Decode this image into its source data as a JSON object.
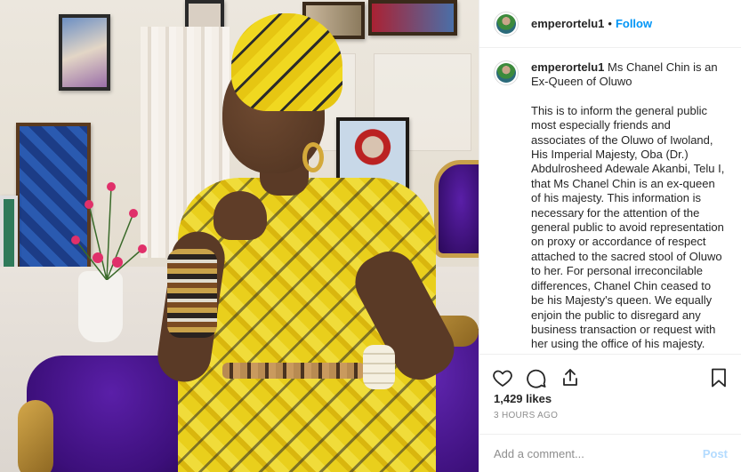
{
  "post": {
    "username": "emperortelu1",
    "separator": "•",
    "follow_label": "Follow",
    "caption_username": "emperortelu1",
    "caption_lead": "Ms Chanel Chin is an Ex-Queen of Oluwo",
    "caption_body": "This is to inform the general public most especially friends and associates of the Oluwo of Iwoland, His Imperial Majesty, Oba (Dr.) Abdulrosheed Adewale Akanbi, Telu I, that Ms Chanel Chin is an ex-queen of his majesty. This information is necessary for the attention of the general public to avoid representation on proxy or accordance of respect attached to the sacred stool of Oluwo to her. For personal irreconcilable differences, Chanel Chin ceased to be his Majesty's queen. We equally enjoin the public to disregard any business transaction or request with her using the office of his majesty.",
    "likes": "1,429 likes",
    "time": "3 HOURS AGO"
  },
  "comment": {
    "placeholder": "Add a comment...",
    "post_label": "Post"
  },
  "icons": {
    "like": "heart-icon",
    "comment": "comment-bubble-icon",
    "share": "share-icon",
    "save": "bookmark-icon"
  },
  "colors": {
    "follow": "#0095f6",
    "post_disabled": "#b3dbff",
    "muted": "#8e8e8e",
    "text": "#262626"
  }
}
